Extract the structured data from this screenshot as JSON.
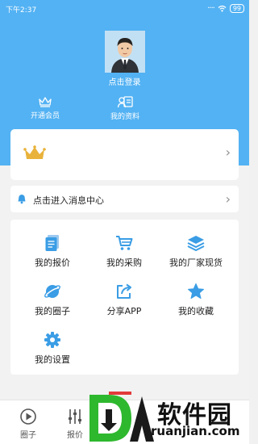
{
  "status_bar": {
    "time": "下午2:37",
    "battery": "99"
  },
  "profile": {
    "login_label": "点击登录"
  },
  "quick_links": [
    {
      "label": "开通会员",
      "icon": "crown-icon"
    },
    {
      "label": "我的资料",
      "icon": "profile-card-icon"
    }
  ],
  "message_center": {
    "label": "点击进入消息中心",
    "icon": "bell-icon"
  },
  "grid": [
    {
      "label": "我的报价",
      "icon": "document-icon"
    },
    {
      "label": "我的采购",
      "icon": "cart-icon"
    },
    {
      "label": "我的厂家现货",
      "icon": "layers-icon"
    },
    {
      "label": "我的圈子",
      "icon": "planet-icon"
    },
    {
      "label": "分享APP",
      "icon": "share-icon"
    },
    {
      "label": "我的收藏",
      "icon": "star-icon"
    },
    {
      "label": "我的设置",
      "icon": "gear-icon"
    }
  ],
  "bottom_nav": [
    {
      "label": "圈子",
      "icon": "circle-play-icon"
    },
    {
      "label": "报价",
      "icon": "sliders-icon"
    }
  ],
  "watermark": {
    "text": "软件园",
    "url": "ruanjian.com"
  },
  "colors": {
    "header_blue": "#53b2f3",
    "icon_blue": "#3a9de5",
    "crown_gold": "#e9b23a"
  }
}
